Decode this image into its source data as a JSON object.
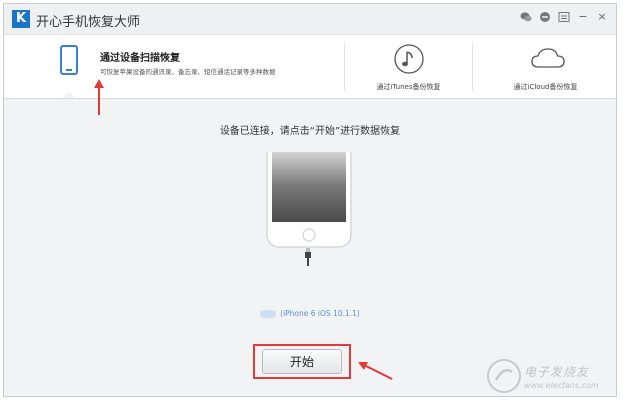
{
  "app": {
    "title": "开心手机恢复大师",
    "logo_letter": "K"
  },
  "window_controls": {
    "wechat_icon": "wechat-icon",
    "feedback_icon": "chat-icon",
    "menu_icon": "menu-icon",
    "minimize": "−",
    "close": "×"
  },
  "tabs": [
    {
      "title": "通过设备扫描恢复",
      "subtitle": "可恢复苹果设备的通讯录、备忘录、短信通话记录等多种数据",
      "icon": "phone-icon",
      "active": true
    },
    {
      "label": "通过iTunes备份恢复",
      "icon": "music-note-icon",
      "active": false
    },
    {
      "label": "通过iCloud备份恢复",
      "icon": "cloud-icon",
      "active": false
    }
  ],
  "main": {
    "instruction": "设备已连接，请点击“开始”进行数据恢复",
    "device_model": "(iPhone 6 iOS 10.1.1)",
    "start_button": "开始"
  },
  "watermark": {
    "text": "电子发烧友",
    "subtext": "www.elecfans.com"
  },
  "colors": {
    "accent_blue": "#3a7fd0",
    "annotation_red": "#e03a3a"
  }
}
